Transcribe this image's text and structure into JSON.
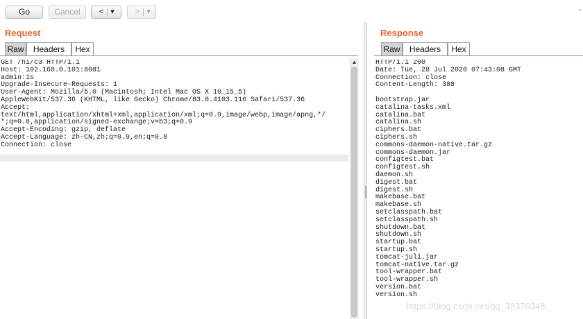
{
  "toolbar": {
    "go_label": "Go",
    "cancel_label": "Cancel",
    "back_label": "<",
    "back_menu_label": "▾",
    "forward_label": ">",
    "forward_menu_label": "▾",
    "corner_mark": "-"
  },
  "request": {
    "title": "Request",
    "tabs": [
      "Raw",
      "Headers",
      "Hex"
    ],
    "active_tab": "Raw",
    "body": "GET /hi/c3 HTTP/1.1\nHost: 192.168.0.101:8081\nadmin:1s\nUpgrade-Insecure-Requests: 1\nUser-Agent: Mozilla/5.0 (Macintosh; Intel Mac OS X 10_15_5)\nAppleWebKit/537.36 (KHTML, like Gecko) Chrome/83.0.4103.116 Safari/537.36\nAccept:\ntext/html,application/xhtml+xml,application/xml;q=0.9,image/webp,image/apng,*/\n*;q=0.8,application/signed-exchange;v=b3;q=0.9\nAccept-Encoding: gzip, deflate\nAccept-Language: zh-CN,zh;q=0.9,en;q=0.8\nConnection: close"
  },
  "response": {
    "title": "Response",
    "tabs": [
      "Raw",
      "Headers",
      "Hex"
    ],
    "active_tab": "Raw",
    "body": "HTTP/1.1 200\nDate: Tue, 28 Jul 2020 07:43:08 GMT\nConnection: close\nContent-Length: 388\n\nbootstrap.jar\ncatalina-tasks.xml\ncatalina.bat\ncatalina.sh\nciphers.bat\nciphers.sh\ncommons-daemon-native.tar.gz\ncommons-daemon.jar\nconfigtest.bat\nconfigtest.sh\ndaemon.sh\ndigest.bat\ndigest.sh\nmakebase.bat\nmakebase.sh\nsetclasspath.bat\nsetclasspath.sh\nshutdown.bat\nshutdown.sh\nstartup.bat\nstartup.sh\ntomcat-juli.jar\ntomcat-native.tar.gz\ntool-wrapper.bat\ntool-wrapper.sh\nversion.bat\nversion.sh"
  },
  "watermark": "https://blog.csdn.net/qq_38376348",
  "colors": {
    "title": "#e8672f",
    "active_tab": "#d4d4d4"
  }
}
